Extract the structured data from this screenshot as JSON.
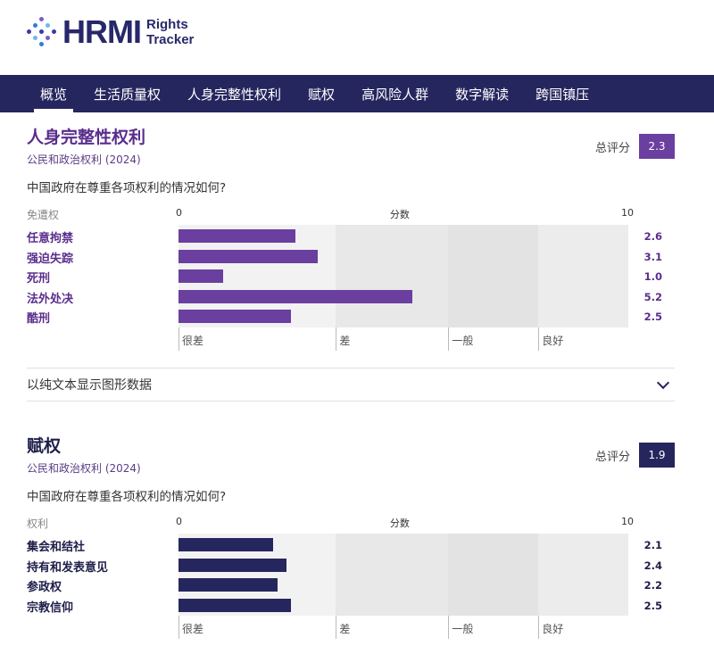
{
  "brand": {
    "name_main": "HRMI",
    "name_sub_line1": "Rights",
    "name_sub_line2": "Tracker",
    "color_navy": "#27286b",
    "dot_colors": [
      "#3a3aa0",
      "#2b7fd1",
      "#6fb8e8",
      "#7a5cc0"
    ]
  },
  "nav": {
    "items": [
      "概览",
      "生活质量权",
      "人身完整性权利",
      "赋权",
      "高风险人群",
      "数字解读",
      "跨国镇压"
    ],
    "active_index": 0,
    "background": "#26265f"
  },
  "sections": [
    {
      "title": "人身完整性权利",
      "subtitle": "公民和政治权利 (2024)",
      "question": "中国政府在尊重各项权利的情况如何?",
      "score_label": "总评分",
      "score": "2.3",
      "accent": "#6b3fa0",
      "title_color": "#5a2d8c",
      "category_header": "免遭权",
      "chart_data": {
        "type": "bar",
        "categories": [
          "任意拘禁",
          "强迫失踪",
          "死刑",
          "法外处决",
          "酷刑"
        ],
        "values": [
          2.6,
          3.1,
          1.0,
          5.2,
          2.5
        ],
        "value_labels": [
          "2.6",
          "3.1",
          "1.0",
          "5.2",
          "2.5"
        ],
        "xlabel": "分数",
        "xlim": [
          0,
          10
        ],
        "x_ticks": [
          "0",
          "10"
        ],
        "bands": [
          "很差",
          "差",
          "一般",
          "良好"
        ]
      }
    },
    {
      "title": "赋权",
      "subtitle": "公民和政治权利 (2024)",
      "question": "中国政府在尊重各项权利的情况如何?",
      "score_label": "总评分",
      "score": "1.9",
      "accent": "#26265f",
      "title_color": "#1e1e4a",
      "category_header": "权利",
      "chart_data": {
        "type": "bar",
        "categories": [
          "集会和结社",
          "持有和发表意见",
          "参政权",
          "宗教信仰"
        ],
        "values": [
          2.1,
          2.4,
          2.2,
          2.5
        ],
        "value_labels": [
          "2.1",
          "2.4",
          "2.2",
          "2.5"
        ],
        "xlabel": "分数",
        "xlim": [
          0,
          10
        ],
        "x_ticks": [
          "0",
          "10"
        ],
        "bands": [
          "很差",
          "差",
          "一般",
          "良好"
        ]
      }
    }
  ],
  "text_toggle": {
    "label": "以纯文本显示图形数据"
  }
}
